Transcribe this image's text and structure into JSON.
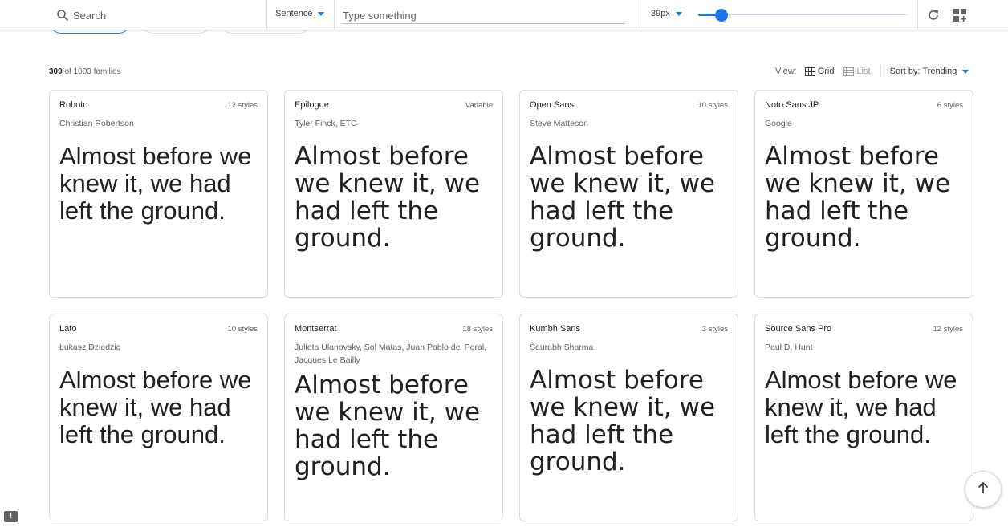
{
  "toolbar": {
    "search_label": "Search",
    "preview_mode": "Sentence",
    "preview_placeholder": "Type something",
    "font_size": "39px",
    "slider_level_fraction": 0.11
  },
  "results": {
    "shown": "309",
    "total_text": "of 1003 families",
    "view_label": "View:",
    "grid_label": "Grid",
    "list_label": "List",
    "sort_label": "Sort by: Trending"
  },
  "sample_text": "Almost before we knew it, we had left the ground.",
  "fonts": [
    {
      "name": "Roboto",
      "styles": "12 styles",
      "author": "Christian Robertson"
    },
    {
      "name": "Epilogue",
      "styles": "Variable",
      "author": "Tyler Finck, ETC"
    },
    {
      "name": "Open Sans",
      "styles": "10 styles",
      "author": "Steve Matteson"
    },
    {
      "name": "Noto Sans JP",
      "styles": "6 styles",
      "author": "Google"
    },
    {
      "name": "Lato",
      "styles": "10 styles",
      "author": "Łukasz Dziedzic"
    },
    {
      "name": "Montserrat",
      "styles": "18 styles",
      "author": "Julieta Ulanovsky, Sol Matas, Juan Pablo del Peral, Jacques Le Bailly"
    },
    {
      "name": "Kumbh Sans",
      "styles": "3 styles",
      "author": "Saurabh Sharma"
    },
    {
      "name": "Source Sans Pro",
      "styles": "12 styles",
      "author": "Paul D. Hunt"
    }
  ],
  "icons": {
    "search": "search-icon",
    "refresh": "refresh-icon",
    "grid_add": "grid-add-icon",
    "back_to_top": "arrow-up-icon",
    "feedback": "feedback-icon"
  },
  "colors": {
    "accent": "#1a73e8",
    "border": "#dadce0",
    "text": "#202124",
    "muted": "#5f6368"
  }
}
